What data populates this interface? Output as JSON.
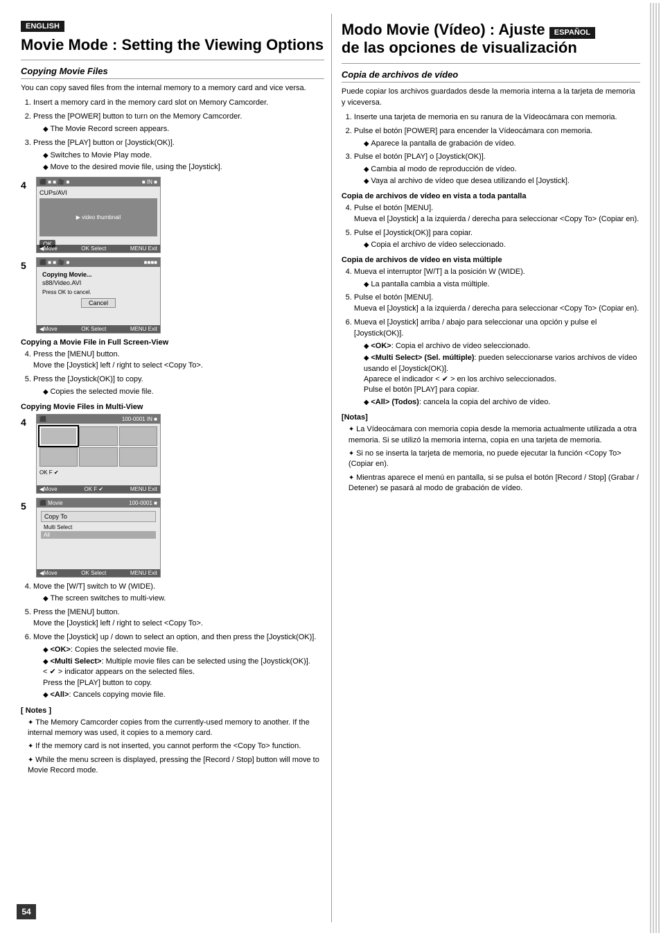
{
  "left": {
    "badge": "ENGLISH",
    "title": "Movie Mode : Setting the Viewing Options",
    "subsection": "Copying Movie Files",
    "intro": "You can copy saved files from the internal memory to a memory card and vice versa.",
    "steps_intro": [
      {
        "num": "1.",
        "text": "Insert a memory card in the memory card slot on Memory Camcorder."
      },
      {
        "num": "2.",
        "text": "Press the [POWER] button to turn on the Memory Camcorder.",
        "sub": [
          "The Movie Record screen appears."
        ]
      },
      {
        "num": "3.",
        "text": "Press the [PLAY] button or [Joystick(OK)].",
        "sub": [
          "Switches to Movie Play mode.",
          "Move to the desired movie file, using the [Joystick]."
        ]
      },
      {
        "num_label": "Copying a Movie File in Full Screen-View"
      },
      {
        "num": "4.",
        "text": "Press the [MENU] button."
      },
      {
        "num": "5.",
        "text": "Press the [Joystick(OK)] to copy.",
        "sub": [
          "Copies the selected movie file."
        ]
      },
      {
        "num_label": "Copying Movie Files in Multi-View"
      },
      {
        "num": "4.",
        "text": "Move the [W/T] switch to W (WIDE).",
        "sub": [
          "The screen switches to multi-view."
        ]
      },
      {
        "num": "5.",
        "text": "Press the [MENU] button.\n      Move the [Joystick] left / right to select <Copy To>."
      },
      {
        "num": "6.",
        "text": "Move the [Joystick] up / down to select an option, and then press the [Joystick(OK)].",
        "sub": [
          "<OK>: Copies the selected movie file.",
          "<Multi Select>: Multiple movie files can be selected using the [Joystick(OK)].\n< ✔ > indicator appears on the selected files.\nPress the [PLAY] button to copy.",
          "<All>: Cancels copying movie file."
        ]
      }
    ],
    "notes_title": "[ Notes ]",
    "notes": [
      "The Memory Camcorder copies from the currently-used memory to another. If the internal memory was used, it copies to a memory card.",
      "If the memory card is not inserted, you cannot perform the <Copy To> function.",
      "While the menu screen is displayed, pressing the [Record / Stop] button will move to Movie Record mode."
    ],
    "page_num": "54"
  },
  "right": {
    "badge": "ESPAÑOL",
    "title": "Modo Movie (Vídeo) : Ajuste de las opciones de visualización",
    "subsection": "Copia de archivos de vídeo",
    "intro": "Puede copiar los archivos guardados desde la memoria interna a la tarjeta de memoria y viceversa.",
    "steps": [
      {
        "num": "1.",
        "text": "Inserte una tarjeta de memoria en su ranura de la Vídeocámara con memoria."
      },
      {
        "num": "2.",
        "text": "Pulse el botón [POWER] para encender la Vídeocámara con memoria.",
        "sub": [
          "Aparece la pantalla de grabación de vídeo."
        ]
      },
      {
        "num": "3.",
        "text": "Pulse el botón [PLAY] o [Joystick(OK)].",
        "sub": [
          "Cambia al modo de reproducción de vídeo.",
          "Vaya al archivo de vídeo que desea utilizando el [Joystick]."
        ]
      },
      {
        "num_label": "Copia de archivos de vídeo en vista a toda pantalla"
      },
      {
        "num": "4.",
        "text": "Pulse el botón [MENU].\n      Mueva el [Joystick] a la izquierda / derecha para seleccionar <Copy To> (Copiar en)."
      },
      {
        "num": "5.",
        "text": "Pulse el [Joystick(OK)] para copiar.",
        "sub": [
          "Copia el archivo de vídeo seleccionado."
        ]
      },
      {
        "num_label": "Copia de archivos de vídeo en vista múltiple"
      },
      {
        "num": "4.",
        "text": "Mueva el interruptor [W/T] a la posición W (WIDE).",
        "sub": [
          "La pantalla cambia a vista múltiple."
        ]
      },
      {
        "num": "5.",
        "text": "Pulse el botón [MENU].\n      Mueva el [Joystick] a la izquierda / derecha para seleccionar <Copy To> (Copiar en)."
      },
      {
        "num": "6.",
        "text": "Mueva el [Joystick] arriba / abajo para seleccionar una opción y pulse el [Joystick(OK)].",
        "sub": [
          "<OK>: Copia el archivo de vídeo seleccionado.",
          "<Multi Select> (Sel. múltiple): pueden seleccionarse varios archivos de vídeo usando el [Joystick(OK)].\nAparece el indicador < ✔ > en los archivo seleccionados.\nPulse el botón [PLAY] para copiar.",
          "<All> (Todos): cancela la copia del archivo de vídeo."
        ]
      }
    ],
    "notes_title": "[Notas]",
    "notes": [
      "La Vídeocámara con memoria copia desde la memoria actualmente utilizada a otra memoria. Si se utilizó la memoria interna, copia en una tarjeta de memoria.",
      "Si no se inserta la tarjeta de memoria, no puede ejecutar la función <Copy To> (Copiar en).",
      "Mientras aparece el menú en pantalla, si se pulsa el botón [Record / Stop] (Grabar / Detener) se pasará al modo de grabación de vídeo."
    ]
  },
  "screens": {
    "screen4_top_bar": "■ IN ■",
    "screen4_filename": "CUPs/AVI",
    "ok_label": "OK",
    "screen5_title": "Copying Movie...",
    "screen5_file": "s88/Video.AVI",
    "press_ok_cancel": "Press OK to cancel.",
    "cancel": "Cancel",
    "multi_top_bar": "100-0001   IN ■",
    "multi_ok": "OK F ✔",
    "screen5b_top": "100-0001   ■",
    "copy_to_label": "Copy To",
    "all_label": "All",
    "move_label": "◀Move",
    "select_label": "OK Select",
    "menu_label": "MENU Exit"
  }
}
